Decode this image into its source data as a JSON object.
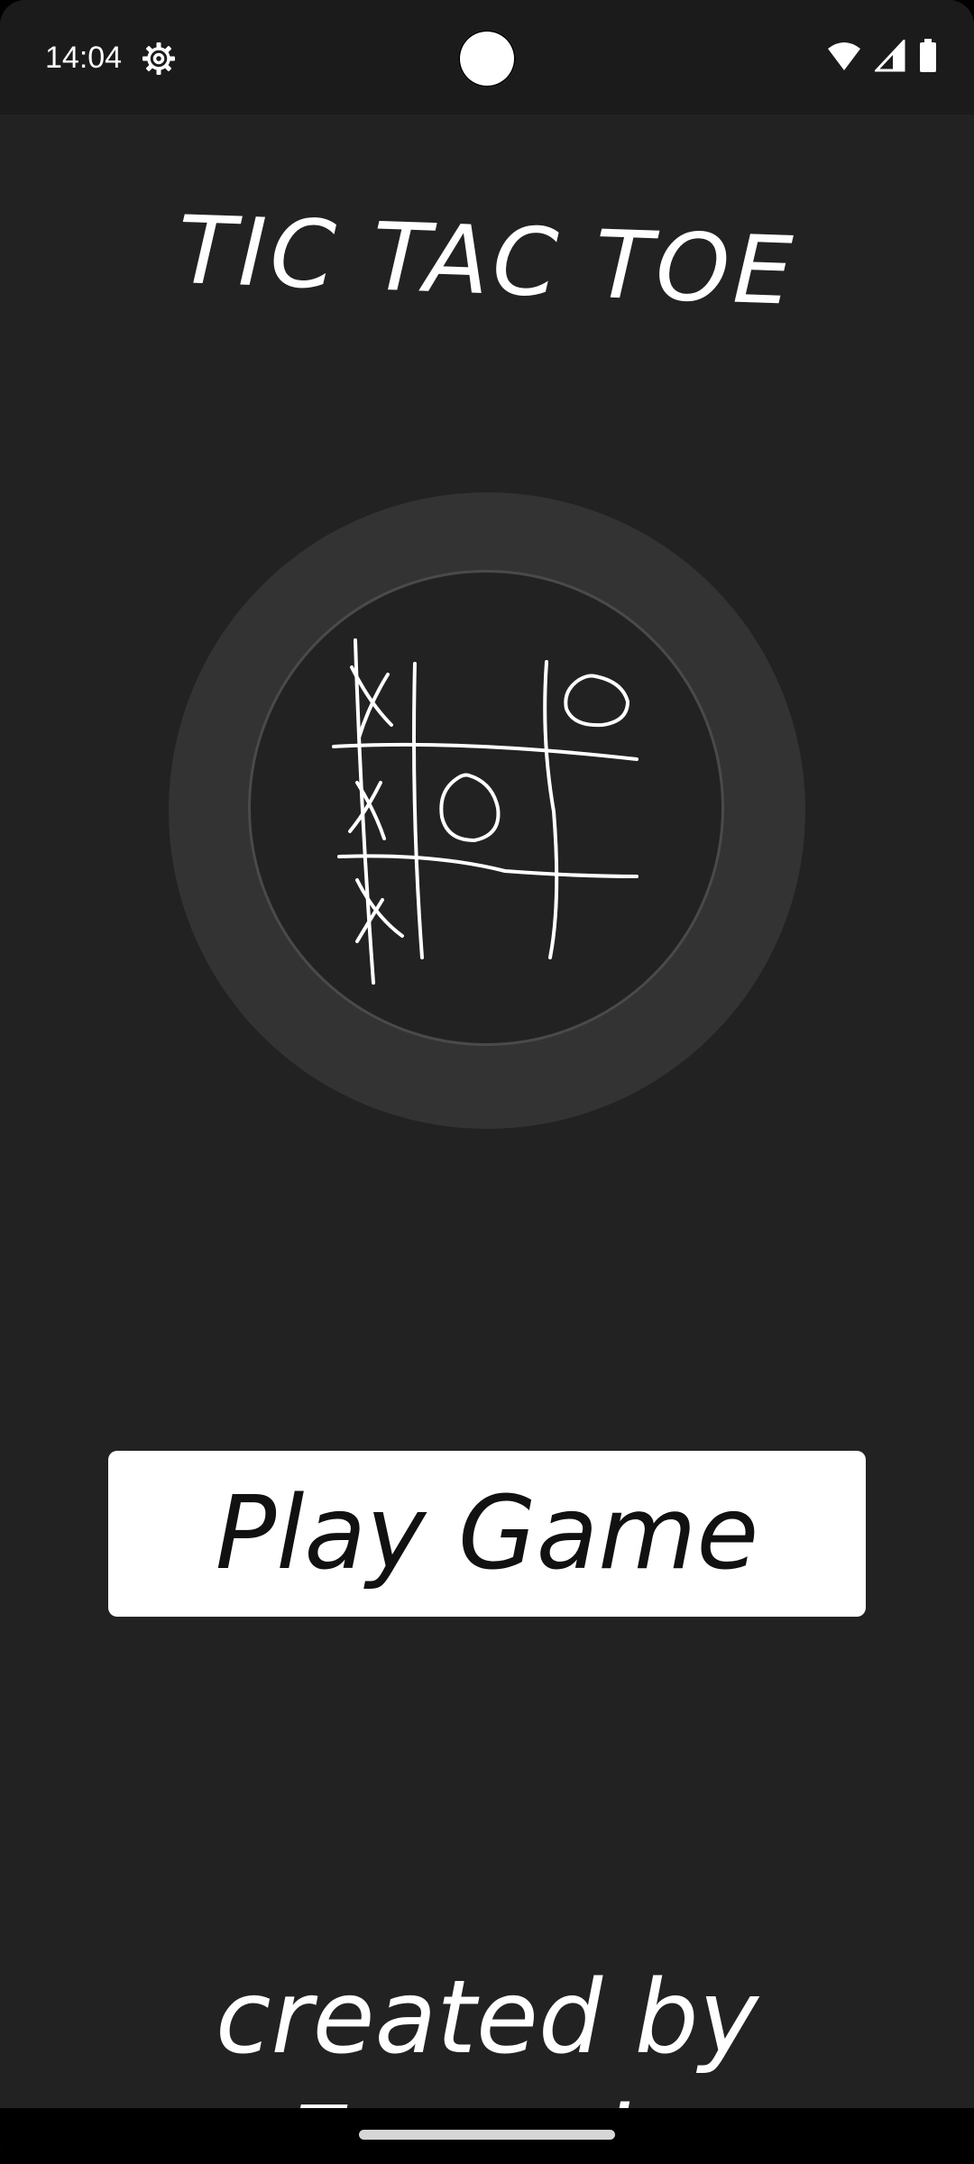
{
  "status_bar": {
    "time": "14:04",
    "settings_icon": "gear-icon",
    "wifi_icon": "wifi-icon",
    "signal_icon": "cell-signal-icon",
    "battery_icon": "battery-icon"
  },
  "title": "TIC TAC TOE",
  "logo": {
    "icon": "tic-tac-toe-board-icon",
    "ring_color": "#333333"
  },
  "play_button": {
    "label": "Play Game"
  },
  "footer": {
    "credits": "created by Eugeniy"
  },
  "colors": {
    "background": "#222222",
    "status_bar": "#1b1b1b",
    "text": "#ffffff",
    "button_bg": "#ffffff",
    "button_text": "#111111"
  }
}
